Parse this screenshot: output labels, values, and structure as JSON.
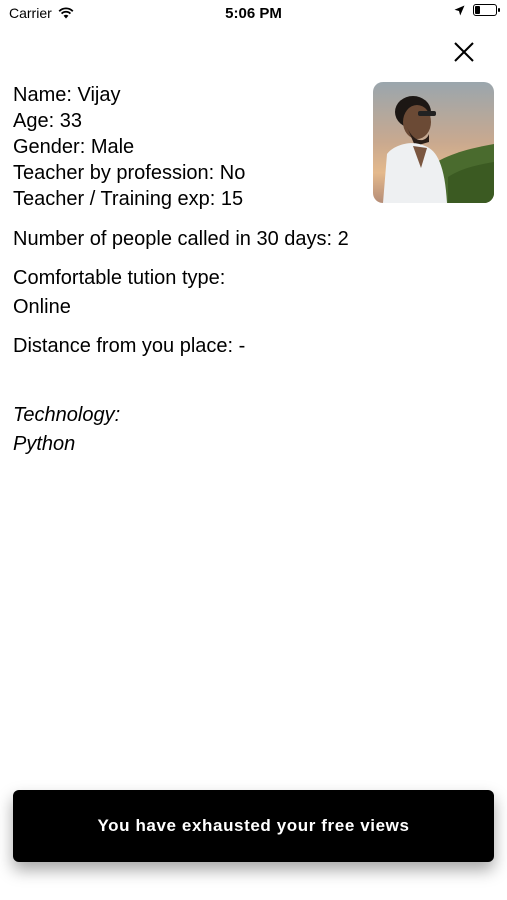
{
  "status_bar": {
    "carrier": "Carrier",
    "time": "5:06 PM",
    "battery_level_pct": 30
  },
  "profile": {
    "name_line": "Name: Vijay",
    "age_line": "Age: 33",
    "gender_line": "Gender:  Male",
    "teacher_line": "Teacher by profession:  No",
    "exp_line": "Teacher / Training exp: 15"
  },
  "called_line": "Number of people called in 30 days: 2",
  "tution": {
    "label": "Comfortable tution type:",
    "value": "Online"
  },
  "distance_line": "Distance from you place: -",
  "technology": {
    "label": "Technology:",
    "value": "Python"
  },
  "cta": {
    "label": "You have exhausted your free views"
  },
  "icons": {
    "close": "close-icon",
    "wifi": "wifi-icon",
    "location": "location-arrow-icon",
    "battery": "battery-icon"
  }
}
